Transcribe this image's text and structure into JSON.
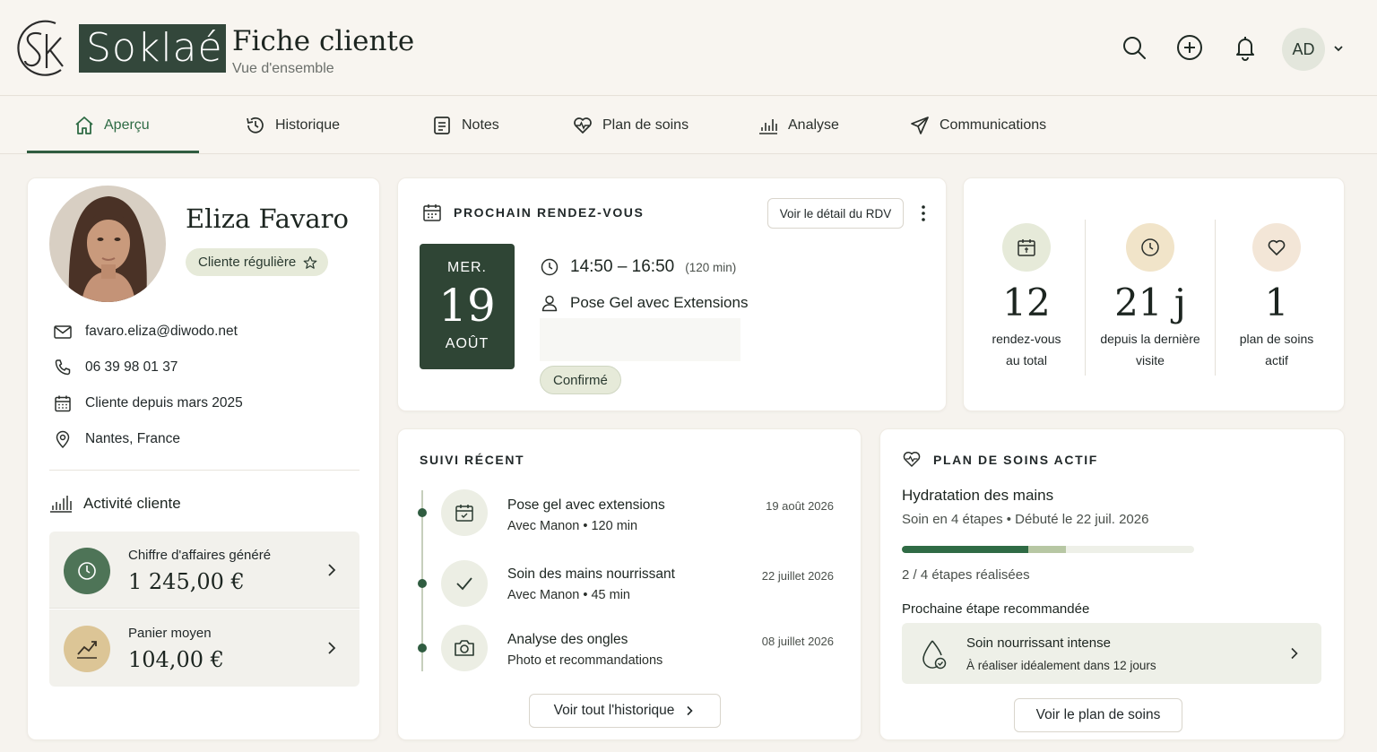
{
  "header": {
    "logo_mark": "SK",
    "logo_text": "Soklaé",
    "title": "Fiche cliente",
    "subtitle": "Vue d'ensemble",
    "user_initials": "AD"
  },
  "tabs": [
    {
      "label": "Aperçu",
      "icon": "home-icon",
      "active": true
    },
    {
      "label": "Historique",
      "icon": "history-icon"
    },
    {
      "label": "Notes",
      "icon": "notes-icon"
    },
    {
      "label": "Plan de soins",
      "icon": "heart-pulse-icon"
    },
    {
      "label": "Analyse",
      "icon": "chart-bars-icon"
    },
    {
      "label": "Communications",
      "icon": "send-icon"
    }
  ],
  "profile": {
    "name": "Eliza Favaro",
    "badge": "Cliente régulière",
    "email": "favaro.eliza@diwodo.net",
    "phone": "06 39 98 01 37",
    "since": "Cliente depuis mars 2025",
    "location": "Nantes, France",
    "activity_title": "Activité cliente",
    "revenue_label": "Chiffre d'affaires généré",
    "revenue_value": "1 245,00 €",
    "basket_label": "Panier moyen",
    "basket_value": "104,00 €"
  },
  "next_appointment": {
    "title": "PROCHAIN RENDEZ-VOUS",
    "detail_button": "Voir le détail du RDV",
    "day_of_week": "MER.",
    "day": "19",
    "month": "AOÛT",
    "time": "14:50 – 16:50",
    "duration": "(120 min)",
    "service": "Pose Gel avec Extensions",
    "status": "Confirmé"
  },
  "kpis": [
    {
      "value": "12",
      "label_line1": "rendez-vous",
      "label_line2": "au total",
      "icon": "calendar-icon"
    },
    {
      "value": "21 j",
      "label_line1": "depuis la dernière",
      "label_line2": "visite",
      "icon": "clock-icon"
    },
    {
      "value": "1",
      "label_line1": "plan de soins",
      "label_line2": "actif",
      "icon": "heart-icon"
    }
  ],
  "recent": {
    "title": "SUIVI RÉCENT",
    "items": [
      {
        "title": "Pose gel avec extensions",
        "sub": "Avec Manon • 120 min",
        "date": "19 août 2026",
        "icon": "calendar-icon"
      },
      {
        "title": "Soin des mains nourrissant",
        "sub": "Avec Manon • 45 min",
        "date": "22 juillet 2026",
        "icon": "check-icon"
      },
      {
        "title": "Analyse des ongles",
        "sub": "Photo et recommandations",
        "date": "08 juillet 2026",
        "icon": "camera-icon"
      }
    ],
    "all_button": "Voir tout l'historique"
  },
  "care_plan": {
    "title": "PLAN DE SOINS ACTIF",
    "name": "Hydratation des mains",
    "subtitle": "Soin en 4 étapes • Débuté le 22 juil. 2026",
    "progress": 0.5,
    "steps_text": "2 / 4 étapes réalisées",
    "next_label": "Prochaine étape recommandée",
    "next_title": "Soin nourrissant intense",
    "next_sub": "À réaliser idéalement dans 12 jours",
    "plan_button": "Voir le plan de soins"
  },
  "colors": {
    "brand_dark": "#33473b",
    "accent_green": "#2f5c40",
    "background": "#f6f3ee",
    "badge_bg": "#e6ead9",
    "gold": "#dcc596"
  }
}
